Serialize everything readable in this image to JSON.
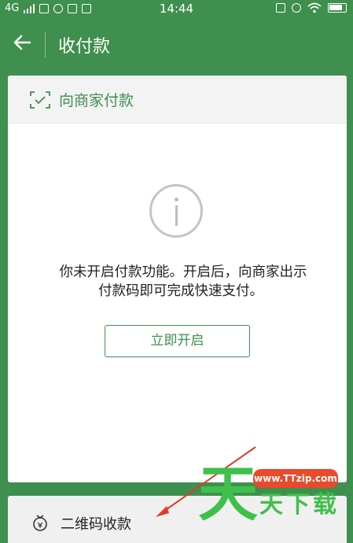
{
  "status_bar": {
    "network": "4G",
    "time": "14:44"
  },
  "app_bar": {
    "title": "收付款"
  },
  "pay_card": {
    "header_title": "向商家付款",
    "message_line1": "你未开启付款功能。开启后，向商家出示",
    "message_line2": "付款码即可完成快速支付。",
    "enable_button_label": "立即开启"
  },
  "qr_section": {
    "label": "二维码收款"
  },
  "watermark": {
    "big_char": "天",
    "url": "www.TTzip.com",
    "chars": [
      "天",
      "下",
      "载"
    ]
  },
  "colors": {
    "primary_green": "#3f8f4e",
    "watermark_green": "#3ec04a",
    "watermark_red": "#e94a2b"
  }
}
